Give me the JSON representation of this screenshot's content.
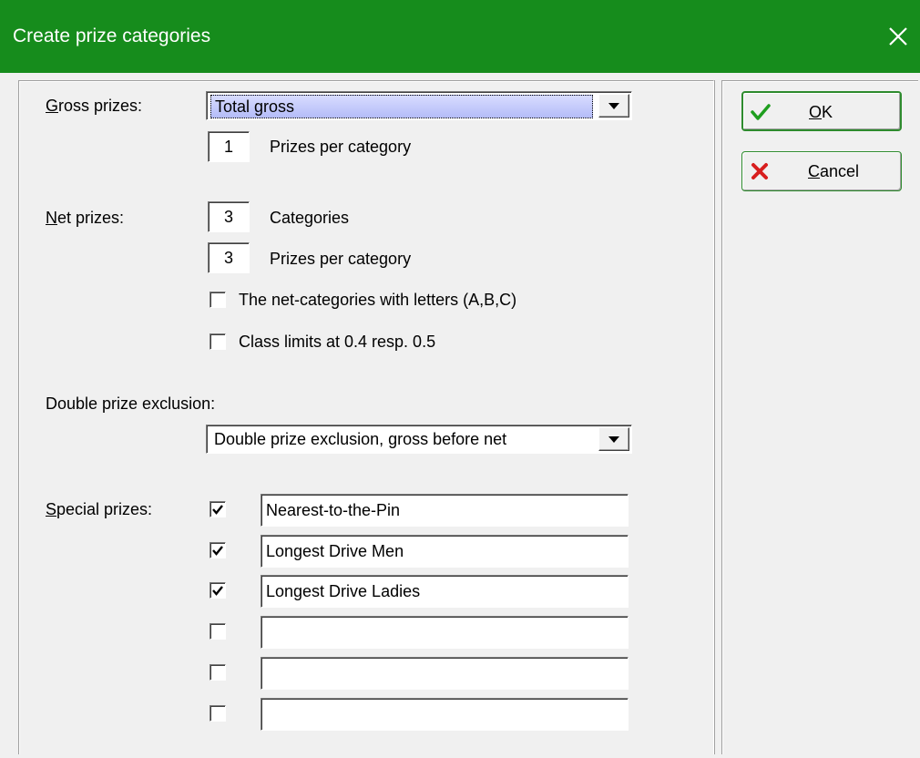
{
  "window": {
    "title": "Create prize categories"
  },
  "gross": {
    "label_accel": "G",
    "label_rest": "ross prizes:",
    "selected": "Total gross",
    "prizes_per_category": "1",
    "prizes_per_category_label": "Prizes per category"
  },
  "net": {
    "label_accel": "N",
    "label_rest": "et prizes:",
    "categories": "3",
    "categories_label": "Categories",
    "prizes_per_category": "3",
    "prizes_per_category_label": "Prizes per category",
    "letters_checkbox_label": "The net-categories with letters (A,B,C)",
    "letters_checked": false,
    "class_limits_label": "Class limits at 0.4 resp. 0.5",
    "class_limits_checked": false
  },
  "double_exclusion": {
    "label": "Double prize exclusion:",
    "selected": "Double prize exclusion, gross before net"
  },
  "special": {
    "label_accel": "S",
    "label_rest": "pecial prizes:",
    "items": [
      {
        "checked": true,
        "value": "Nearest-to-the-Pin"
      },
      {
        "checked": true,
        "value": "Longest Drive Men"
      },
      {
        "checked": true,
        "value": "Longest Drive Ladies"
      },
      {
        "checked": false,
        "value": ""
      },
      {
        "checked": false,
        "value": ""
      },
      {
        "checked": false,
        "value": ""
      }
    ]
  },
  "buttons": {
    "ok_accel": "O",
    "ok_rest": "K",
    "cancel_accel": "C",
    "cancel_rest": "ancel"
  },
  "colors": {
    "titlebar": "#168c1c",
    "ok_icon": "#1e9e1e",
    "cancel_icon": "#d81e1e",
    "selection": "#b4bcf8"
  },
  "icons": {
    "close": "close-icon",
    "ok": "check-icon",
    "cancel": "x-icon",
    "dropdown": "chevron-down-icon"
  }
}
